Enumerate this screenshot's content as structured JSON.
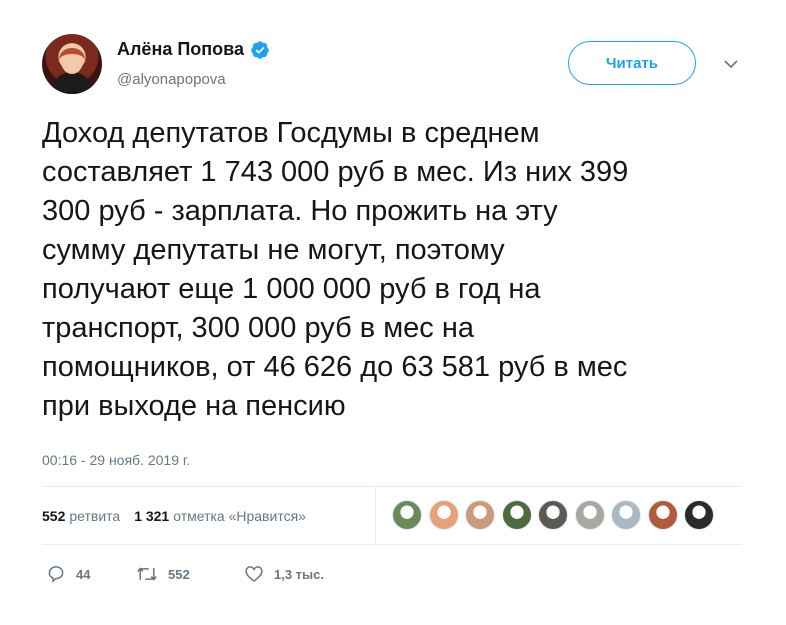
{
  "author": {
    "name": "Алёна Попова",
    "handle": "@alyonapopova",
    "verified": true
  },
  "follow_button": {
    "label": "Читать"
  },
  "tweet": {
    "lines": [
      "Доход депутатов Госдумы в среднем",
      "составляет 1 743 000 руб в мес. Из них 399",
      "300 руб - зарплата. Но прожить на эту",
      "сумму депутаты не могут, поэтому",
      "получают еще 1 000 000 руб в год на",
      "транспорт, 300 000 руб в мес на",
      "помощников, от 46 626 до 63 581 руб в мес",
      "при выходе на пенсию"
    ],
    "timestamp": "00:16 - 29 нояб. 2019 г."
  },
  "stats": {
    "retweets_count": "552",
    "retweets_label": "ретвита",
    "likes_count": "1 321",
    "likes_label": "отметка «Нравится»"
  },
  "liker_avatar_colors": [
    "#6a8a5c",
    "#e8a07a",
    "#c99b7b",
    "#4d6b3e",
    "#5a5a52",
    "#a8a8a0",
    "#aab8c2",
    "#b45a3c",
    "#2a2a2a"
  ],
  "actions": {
    "reply_count": "44",
    "retweet_count": "552",
    "like_count": "1,3 тыс."
  },
  "colors": {
    "accent": "#1da1f2",
    "muted": "#657786",
    "text": "#14171a"
  },
  "icons": {
    "verified": "verified-badge-icon",
    "caret": "chevron-down-icon",
    "reply": "reply-icon",
    "retweet": "retweet-icon",
    "like": "heart-icon"
  }
}
